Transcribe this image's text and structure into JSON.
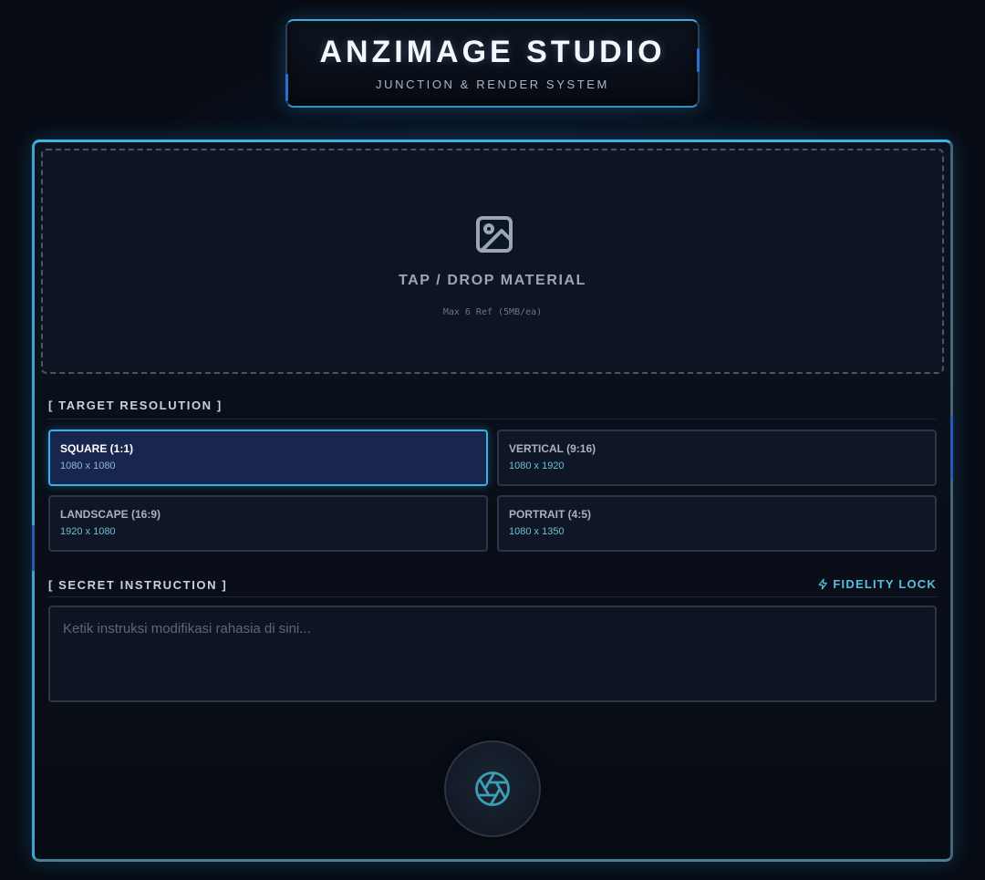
{
  "header": {
    "title": "ANZIMAGE STUDIO",
    "subtitle": "JUNCTION & RENDER SYSTEM"
  },
  "dropzone": {
    "icon": "image-icon",
    "title": "TAP / DROP MATERIAL",
    "hint": "Max 6 Ref (5MB/ea)"
  },
  "resolution": {
    "label": "[ TARGET RESOLUTION ]",
    "options": [
      {
        "name": "SQUARE (1:1)",
        "dims": "1080 x 1080",
        "selected": true
      },
      {
        "name": "VERTICAL (9:16)",
        "dims": "1080 x 1920",
        "selected": false
      },
      {
        "name": "LANDSCAPE (16:9)",
        "dims": "1920 x 1080",
        "selected": false
      },
      {
        "name": "PORTRAIT (4:5)",
        "dims": "1080 x 1350",
        "selected": false
      }
    ]
  },
  "instruction": {
    "label": "[ SECRET INSTRUCTION ]",
    "fidelity_label": "FIDELITY LOCK",
    "fidelity_icon": "lightning-icon",
    "value": "",
    "placeholder": "Ketik instruksi modifikasi rahasia di sini..."
  },
  "generate": {
    "icon": "aperture-icon"
  },
  "colors": {
    "accent": "#37b3df",
    "selected_bg": "#18264f",
    "background": "#070b13"
  }
}
